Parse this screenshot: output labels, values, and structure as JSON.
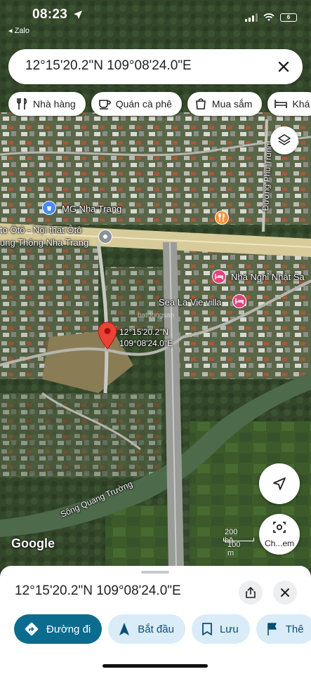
{
  "status_bar": {
    "time": "08:23",
    "back_app": "◂ Zalo",
    "battery": "6"
  },
  "search": {
    "query": "12°15'20.2\"N 109°08'24.0\"E"
  },
  "chips": [
    {
      "label": "Nhà hàng",
      "icon": "restaurant-icon"
    },
    {
      "label": "Quán cà phê",
      "icon": "coffee-icon"
    },
    {
      "label": "Mua sắm",
      "icon": "shopping-bag-icon"
    },
    {
      "label": "Khá",
      "icon": "hotel-bed-icon"
    }
  ],
  "map": {
    "labels": {
      "mg": "MG Nha Trang",
      "oto1": "to Ôtô - Nội thất Ôtô",
      "oto2": "ung Thông Nha Trang",
      "nha_nghi": "Nhà Nghỉ Nhật Sa",
      "sea_la_vie": "Sea La Vie villa",
      "street": "Đường Phú Trung",
      "river": "Sông Quang Trường",
      "watermark": "batdongsan"
    },
    "pin": {
      "line1": "12°15'20.2\"N",
      "line2": "109°08'24.0\"E"
    },
    "google_logo": "Google",
    "scale": {
      "imperial": "200 bộ",
      "metric": "100 m"
    },
    "lens_label": "Ch...em"
  },
  "sheet": {
    "coords": "12°15'20.2\"N 109°08'24.0\"E",
    "actions": [
      {
        "label": "Đường đi",
        "icon": "directions-icon"
      },
      {
        "label": "Bắt đầu",
        "icon": "navigation-arrow-icon"
      },
      {
        "label": "Lưu",
        "icon": "bookmark-icon"
      },
      {
        "label": "Thê",
        "icon": "flag-icon"
      }
    ]
  },
  "colors": {
    "primary": "#0b6c8f",
    "tonal": "#d9ecf7",
    "pin": "#ea4335",
    "poi_pink": "#e0437c",
    "poi_orange": "#f29339",
    "poi_blue": "#4c8bf5"
  }
}
